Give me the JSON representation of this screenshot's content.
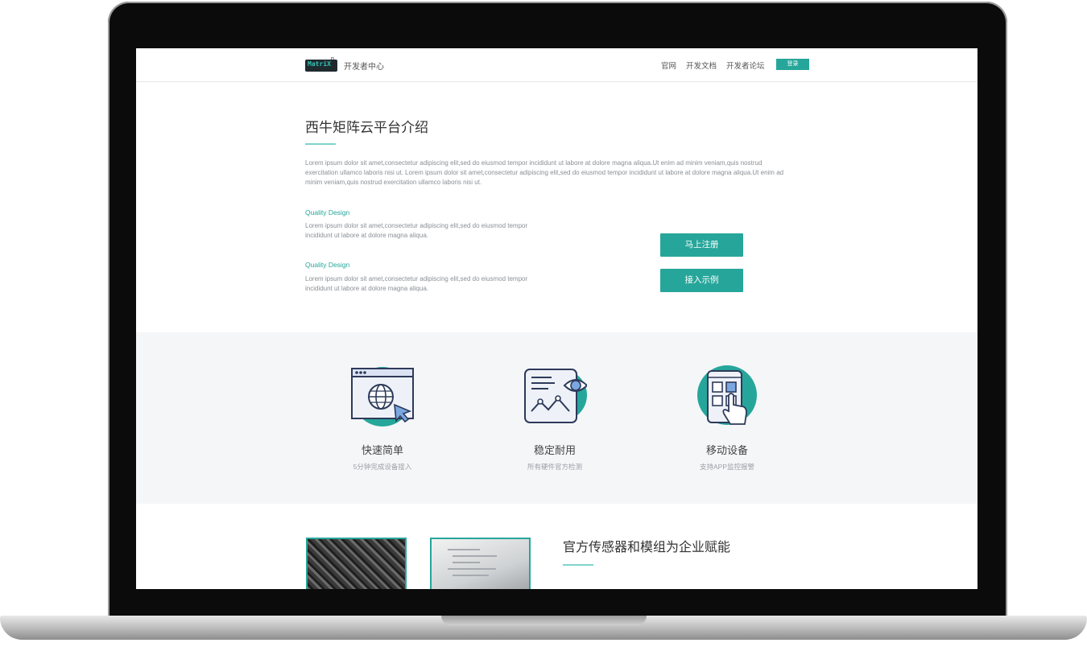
{
  "nav": {
    "logo_text": "MatriX",
    "logo_sup": "n",
    "title": "开发者中心",
    "links": [
      "官网",
      "开发文档",
      "开发者论坛"
    ],
    "login": "登录"
  },
  "intro": {
    "title": "西牛矩阵云平台介绍",
    "text": "Lorem ipsum dolor sit amet,consectetur adipiscing elit,sed do eiusmod tempor incididunt ut labore at dolore magna aliqua.Ut enim ad minim veniam,quis nostrud exercitation ullamco laboris nisi ut. Lorem ipsum dolor sit amet,consectetur adipiscing elit,sed do eiusmod tempor incididunt ut labore at dolore magna aliqua.Ut enim ad minim veniam,quis nostrud exercitation ullamco laboris nisi ut."
  },
  "features": [
    {
      "title": "Quality Design",
      "text": "Lorem ipsum dolor sit amet,consectetur adipiscing elit,sed do eiusmod tempor incididunt ut labore at dolore magna aliqua."
    },
    {
      "title": "Quality Design",
      "text": "Lorem ipsum dolor sit amet,consectetur adipiscing elit,sed do eiusmod tempor incididunt ut labore at dolore magna aliqua."
    }
  ],
  "cta": {
    "register": "马上注册",
    "example": "接入示例"
  },
  "services": [
    {
      "title": "快速简单",
      "sub": "5分钟完成设备接入",
      "icon": "browser-globe-icon"
    },
    {
      "title": "稳定耐用",
      "sub": "所有硬件官方检测",
      "icon": "chart-eye-icon"
    },
    {
      "title": "移动设备",
      "sub": "支持APP监控报警",
      "icon": "mobile-touch-icon"
    }
  ],
  "section3": {
    "title": "官方传感器和模组为企业赋能"
  },
  "colors": {
    "accent": "#26a69a",
    "accent_light": "#7fd3cb",
    "band_bg": "#f5f6f8",
    "text_muted": "#8a8f94"
  }
}
